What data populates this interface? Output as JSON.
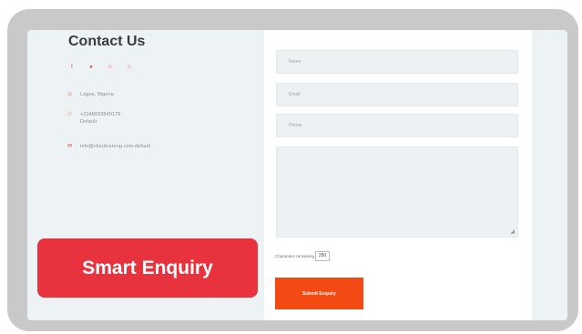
{
  "contact": {
    "title": "Contact Us",
    "socials": [
      {
        "icon": "facebook-icon",
        "glyph": "f",
        "color": "#e8464a"
      },
      {
        "icon": "twitter-icon",
        "glyph": "●",
        "color": "#e8464a"
      },
      {
        "icon": "linkedin-icon",
        "glyph": "in",
        "color": "#f2a3a6"
      },
      {
        "icon": "instagram-icon",
        "glyph": "◎",
        "color": "#f2a3a6"
      }
    ],
    "location": "Lagos, Nigeria",
    "phone_line1": "+2348033840179",
    "phone_line2": "Default",
    "email": "info@cloudcareng.com.default"
  },
  "form": {
    "name_placeholder": "Name",
    "email_placeholder": "Email",
    "phone_placeholder": "Phone",
    "chars_label": "Characters remaining",
    "chars_remaining": "250",
    "submit_label": "Submit Enquiry"
  },
  "badge": {
    "label": "Smart Enquiry"
  },
  "colors": {
    "accent_red": "#e8333f",
    "submit_orange": "#f24a12",
    "frame_gray": "#c9c9c9",
    "page_bg": "#edf2f5"
  }
}
